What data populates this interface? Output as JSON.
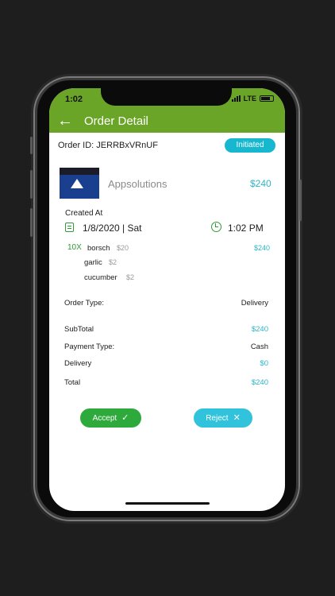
{
  "status_bar": {
    "time": "1:02",
    "network": "LTE"
  },
  "header": {
    "title": "Order Detail"
  },
  "order": {
    "id_text": "Order ID: JERRBxVRnUF",
    "status": "Initiated"
  },
  "merchant": {
    "name": "Appsolutions",
    "price": "$240"
  },
  "created": {
    "label": "Created At",
    "date": "1/8/2020 | Sat",
    "time": "1:02 PM"
  },
  "items": [
    {
      "qty": "10X",
      "name": "borsch",
      "price": "$20",
      "total": "$240",
      "addons": [
        {
          "name": "garlic",
          "price": "$2"
        },
        {
          "name": "cucumber",
          "price": "$2"
        }
      ]
    }
  ],
  "summary": {
    "order_type_label": "Order Type:",
    "order_type": "Delivery",
    "subtotal_label": "SubTotal",
    "subtotal": "$240",
    "payment_type_label": "Payment Type:",
    "payment_type": "Cash",
    "delivery_label": "Delivery",
    "delivery": "$0",
    "total_label": "Total",
    "total": "$240"
  },
  "actions": {
    "accept_label": "Accept",
    "reject_label": "Reject"
  },
  "colors": {
    "header": "#6aa528",
    "accent_teal": "#2bb5c8",
    "accept": "#2eaa3c",
    "reject": "#31c3dc"
  },
  "icons": [
    "back-arrow-icon",
    "calendar-icon",
    "clock-icon",
    "check-icon",
    "close-icon"
  ]
}
